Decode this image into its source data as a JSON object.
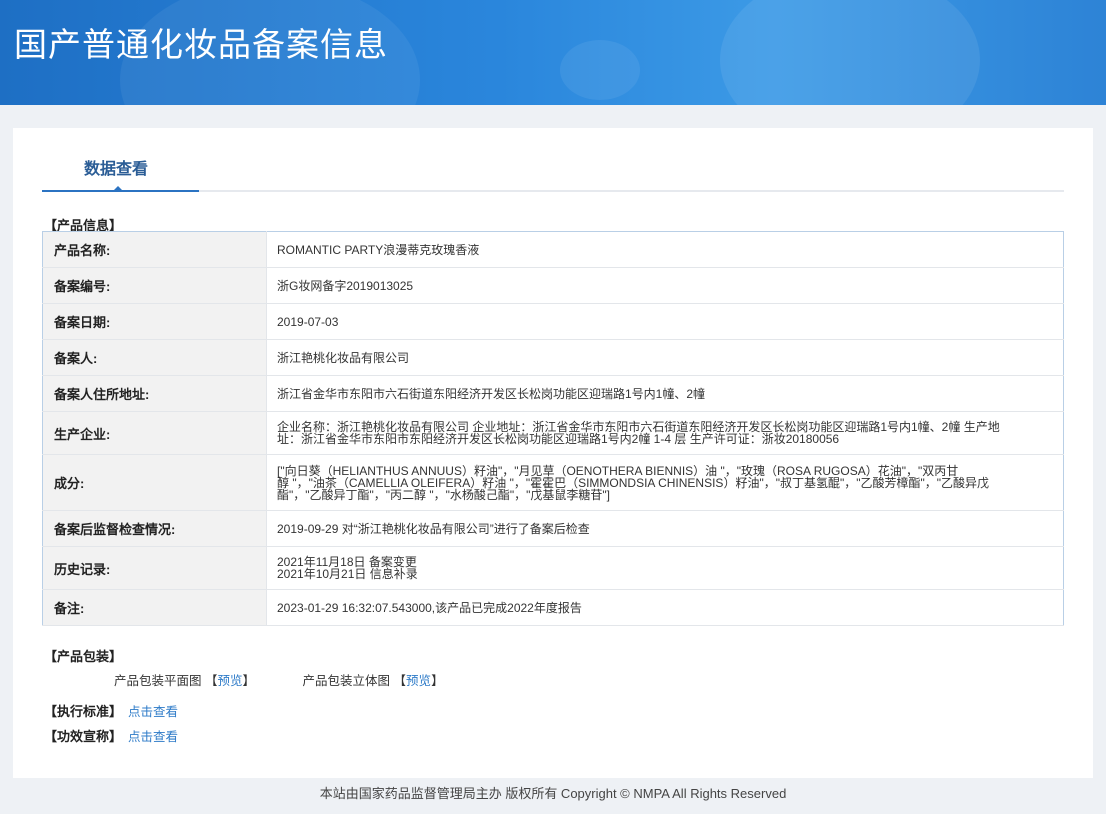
{
  "header": {
    "title": "国产普通化妆品备案信息"
  },
  "tabs": [
    {
      "label": "数据查看"
    }
  ],
  "product_info": {
    "section_title": "【产品信息】",
    "rows": [
      {
        "label": "产品名称:",
        "lines": [
          "ROMANTIC PARTY浪漫蒂克玫瑰香液"
        ]
      },
      {
        "label": "备案编号:",
        "lines": [
          "浙G妆网备字2019013025"
        ]
      },
      {
        "label": "备案日期:",
        "lines": [
          "2019-07-03"
        ]
      },
      {
        "label": "备案人:",
        "lines": [
          "浙江艳桃化妆品有限公司"
        ]
      },
      {
        "label": "备案人住所地址:",
        "lines": [
          "浙江省金华市东阳市六石街道东阳经济开发区长松岗功能区迎瑞路1号内1幢、2幢"
        ]
      },
      {
        "label": "生产企业:",
        "lines": [
          "企业名称：浙江艳桃化妆品有限公司 企业地址：浙江省金华市东阳市六石街道东阳经济开发区长松岗功能区迎瑞路1号内1幢、2幢 生产地",
          "址：浙江省金华市东阳市东阳经济开发区长松岗功能区迎瑞路1号内2幢 1-4 层 生产许可证：浙妆20180056"
        ]
      },
      {
        "label": "成分:",
        "lines": [
          "[\"向日葵（HELIANTHUS ANNUUS）籽油\"，\"月见草（OENOTHERA BIENNIS）油 \"，\"玫瑰（ROSA RUGOSA）花油\"，\"双丙甘",
          "醇 \"，\"油茶（CAMELLIA OLEIFERA）籽油 \"，\"霍霍巴（SIMMONDSIA CHINENSIS）籽油\"，\"叔丁基氢醌\"，\"乙酸芳樟酯\"，\"乙酸异戊",
          "酯\"，\"乙酸异丁酯\"，\"丙二醇 \"，\"水杨酸己酯\"，\"戊基鼠李糖苷\"]"
        ]
      },
      {
        "label": "备案后监督检查情况:",
        "lines": [
          "2019-09-29 对“浙江艳桃化妆品有限公司”进行了备案后检查"
        ]
      },
      {
        "label": "历史记录:",
        "lines": [
          "2021年11月18日 备案变更",
          "2021年10月21日 信息补录"
        ]
      },
      {
        "label": "备注:",
        "lines": [
          "2023-01-29 16:32:07.543000,该产品已完成2022年度报告"
        ]
      }
    ]
  },
  "packaging": {
    "section_title": "【产品包装】",
    "items": [
      {
        "label": "产品包装平面图",
        "bracket_open": "【",
        "link": "预览",
        "bracket_close": "】"
      },
      {
        "label": "产品包装立体图",
        "bracket_open": "【",
        "link": "预览",
        "bracket_close": "】"
      }
    ]
  },
  "standard": {
    "label": "【执行标准】",
    "link": "点击查看"
  },
  "efficacy": {
    "label": "【功效宣称】",
    "link": "点击查看"
  },
  "footer": {
    "text": "本站由国家药品监督管理局主办 版权所有 Copyright © NMPA All Rights Reserved"
  }
}
